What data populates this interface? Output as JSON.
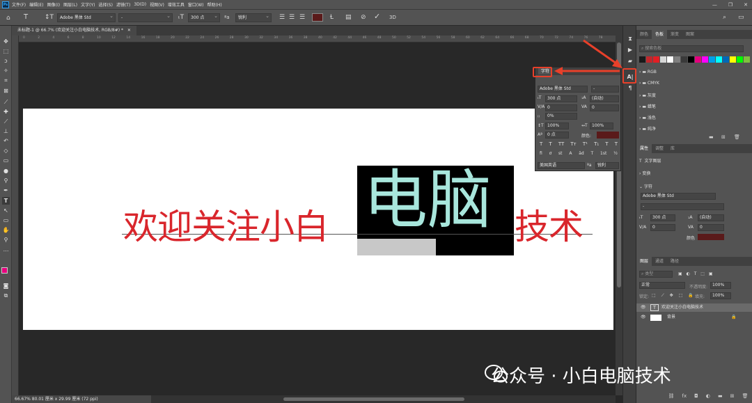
{
  "menu": {
    "items": [
      "文件(F)",
      "编辑(E)",
      "图像(I)",
      "图层(L)",
      "文字(Y)",
      "选择(S)",
      "滤镜(T)",
      "3D(D)",
      "视图(V)",
      "增效工具",
      "窗口(W)",
      "帮助(H)"
    ],
    "logo": "Ps"
  },
  "options": {
    "font_family": "Adobe 黑体 Std",
    "font_style": "-",
    "font_size": "300 点",
    "antialias": "锐利",
    "text_color": "#5a1a1a"
  },
  "doc_tab": {
    "title": "未标题-1 @ 66.7% (欢迎关注小白电脑技术, RGB/8#) *"
  },
  "ruler_ticks": [
    "0",
    "2",
    "4",
    "6",
    "8",
    "10",
    "12",
    "14",
    "16",
    "18",
    "20",
    "22",
    "24",
    "26",
    "28",
    "30",
    "32",
    "34",
    "36",
    "38",
    "40",
    "42",
    "44",
    "46",
    "48",
    "50",
    "52",
    "54",
    "56",
    "58",
    "60",
    "62",
    "64",
    "66",
    "68",
    "70",
    "72",
    "74",
    "76",
    "78"
  ],
  "canvas": {
    "text_before": "欢迎关注小白",
    "text_highlight": "电脑",
    "text_after": "技术",
    "text_color": "#d9262c",
    "highlight_text_color": "#a8e6dc"
  },
  "status": {
    "zoom_info": "66.67% 80.01 厘米 x 29.99 厘米 (72 ppi)"
  },
  "char_panel": {
    "title": "字符",
    "font_family": "Adobe 黑体 Std",
    "font_style": "-",
    "size": "300 点",
    "leading": "(自动)",
    "kerning": "0",
    "tracking": "0",
    "tsume": "0%",
    "vscale": "100%",
    "hscale": "100%",
    "baseline": "0 点",
    "color_label": "颜色:",
    "color": "#5a1a1a",
    "style_buttons": [
      "T",
      "T",
      "TT",
      "Tт",
      "T¹",
      "T₁",
      "T",
      "T"
    ],
    "ot_buttons": [
      "fi",
      "ơ",
      "st",
      "A",
      "ād",
      "T",
      "1st",
      "½"
    ],
    "language": "美国英语",
    "aa_icon": "ªa",
    "antialias": "锐利"
  },
  "right_panel": {
    "top_tabs": [
      "颜色",
      "色板",
      "渐变",
      "图案"
    ],
    "active_top_tab": "色板",
    "swatch_search": "搜索色板",
    "swatch_colors": [
      "#1a1a1a",
      "#c0282d",
      "#e31e24",
      "#d7d7d7",
      "#ffffff",
      "#808080",
      "#3a3a3a",
      "#000000",
      "#e6007e",
      "#ff00ff",
      "#00a0e9",
      "#00ffff",
      "#0068b7",
      "#ffff00",
      "#00ff00",
      "#7fbf3f"
    ],
    "swatch_groups": [
      "RGB",
      "CMYK",
      "灰度",
      "蜡笔",
      "浅色",
      "纯净"
    ],
    "props_tabs": [
      "属性",
      "调整",
      "库"
    ],
    "active_props_tab": "属性",
    "layer_kind": "文字图层",
    "transform_label": "变换",
    "char_label": "字符",
    "props_font": "Adobe 黑体 Std",
    "props_style": "-",
    "props_size": "300 点",
    "props_leading": "(自动)",
    "props_kern": "0",
    "props_track": "0",
    "props_color_label": "颜色",
    "props_color": "#5a1a1a",
    "layers_tabs": [
      "图层",
      "通道",
      "路径"
    ],
    "active_layers_tab": "图层",
    "layer_filter": "类型",
    "blend_mode": "正常",
    "opacity_label": "不透明度:",
    "opacity": "100%",
    "lock_label": "锁定:",
    "fill_label": "填充:",
    "fill": "100%",
    "layers": [
      {
        "name": "欢迎关注小白电脑技术",
        "type": "text"
      },
      {
        "name": "背景",
        "type": "pixel"
      }
    ],
    "bottom_icons": [
      "link-icon",
      "fx-icon",
      "mask-icon",
      "adjust-icon",
      "folder-icon",
      "new-layer-icon",
      "trash-icon"
    ]
  },
  "watermark": {
    "text": "公众号 · 小白电脑技术"
  }
}
